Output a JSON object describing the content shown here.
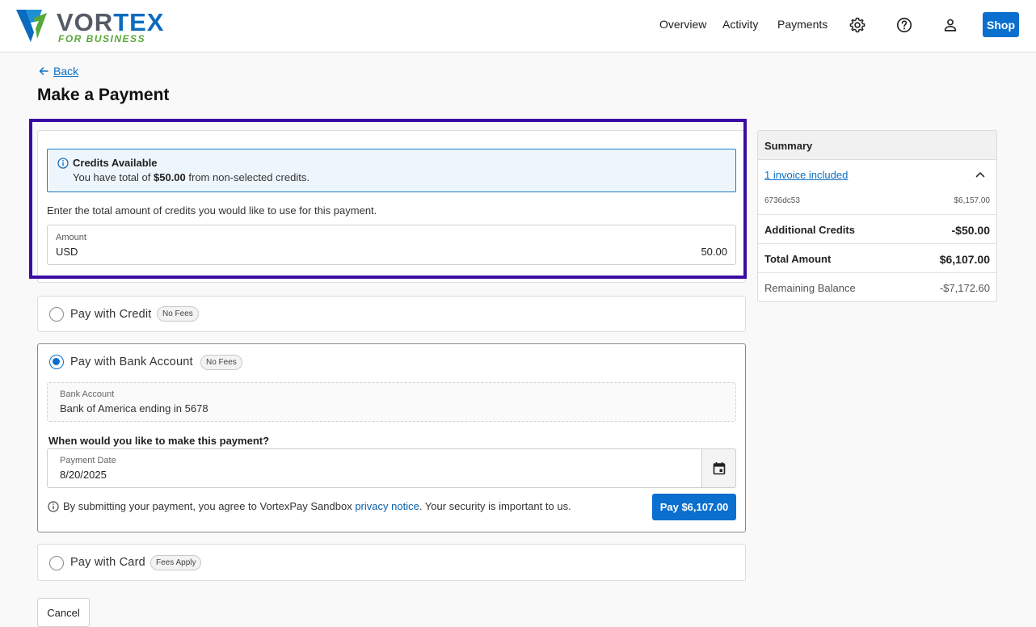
{
  "brand": {
    "wordmark_a": "VOR",
    "wordmark_b": "TEX",
    "tagline": "FOR BUSINESS",
    "colors": {
      "primary": "#0a6fce",
      "accent_green": "#58a839",
      "highlight": "#3a0ca3"
    }
  },
  "nav": {
    "items": [
      "Overview",
      "Activity",
      "Payments"
    ],
    "icons": [
      "gear-icon",
      "help-icon",
      "user-icon"
    ],
    "shop_label": "Shop"
  },
  "page": {
    "back_label": "Back",
    "title": "Make a Payment"
  },
  "credits": {
    "alert_title": "Credits Available",
    "alert_prefix": "You have total of ",
    "alert_amount": "$50.00",
    "alert_suffix": " from non-selected credits.",
    "help_text": "Enter the total amount of credits you would like to use for this payment.",
    "amount_label": "Amount",
    "currency": "USD",
    "amount_value": "50.00"
  },
  "payment_options": {
    "credit": {
      "label": "Pay with Credit",
      "badge": "No Fees",
      "selected": false
    },
    "bank": {
      "label": "Pay with Bank Account",
      "badge": "No Fees",
      "selected": true,
      "account_label": "Bank Account",
      "account_value": "Bank of America ending in 5678",
      "when_question": "When would you like to make this payment?",
      "date_label": "Payment Date",
      "date_value": "8/20/2025",
      "consent_prefix": "By submitting your payment, you agree to VortexPay Sandbox ",
      "consent_link": "privacy notice",
      "consent_suffix": ". Your security is important to us.",
      "pay_button": "Pay $6,107.00"
    },
    "card": {
      "label": "Pay with Card",
      "badge": "Fees Apply",
      "selected": false
    }
  },
  "cancel_label": "Cancel",
  "summary": {
    "title": "Summary",
    "invoices_link": "1 invoice included",
    "invoice_id": "6736dc53",
    "invoice_amount": "$6,157.00",
    "additional_credits_label": "Additional Credits",
    "additional_credits_value": "-$50.00",
    "total_label": "Total Amount",
    "total_value": "$6,107.00",
    "remaining_label": "Remaining Balance",
    "remaining_value": "-$7,172.60"
  }
}
